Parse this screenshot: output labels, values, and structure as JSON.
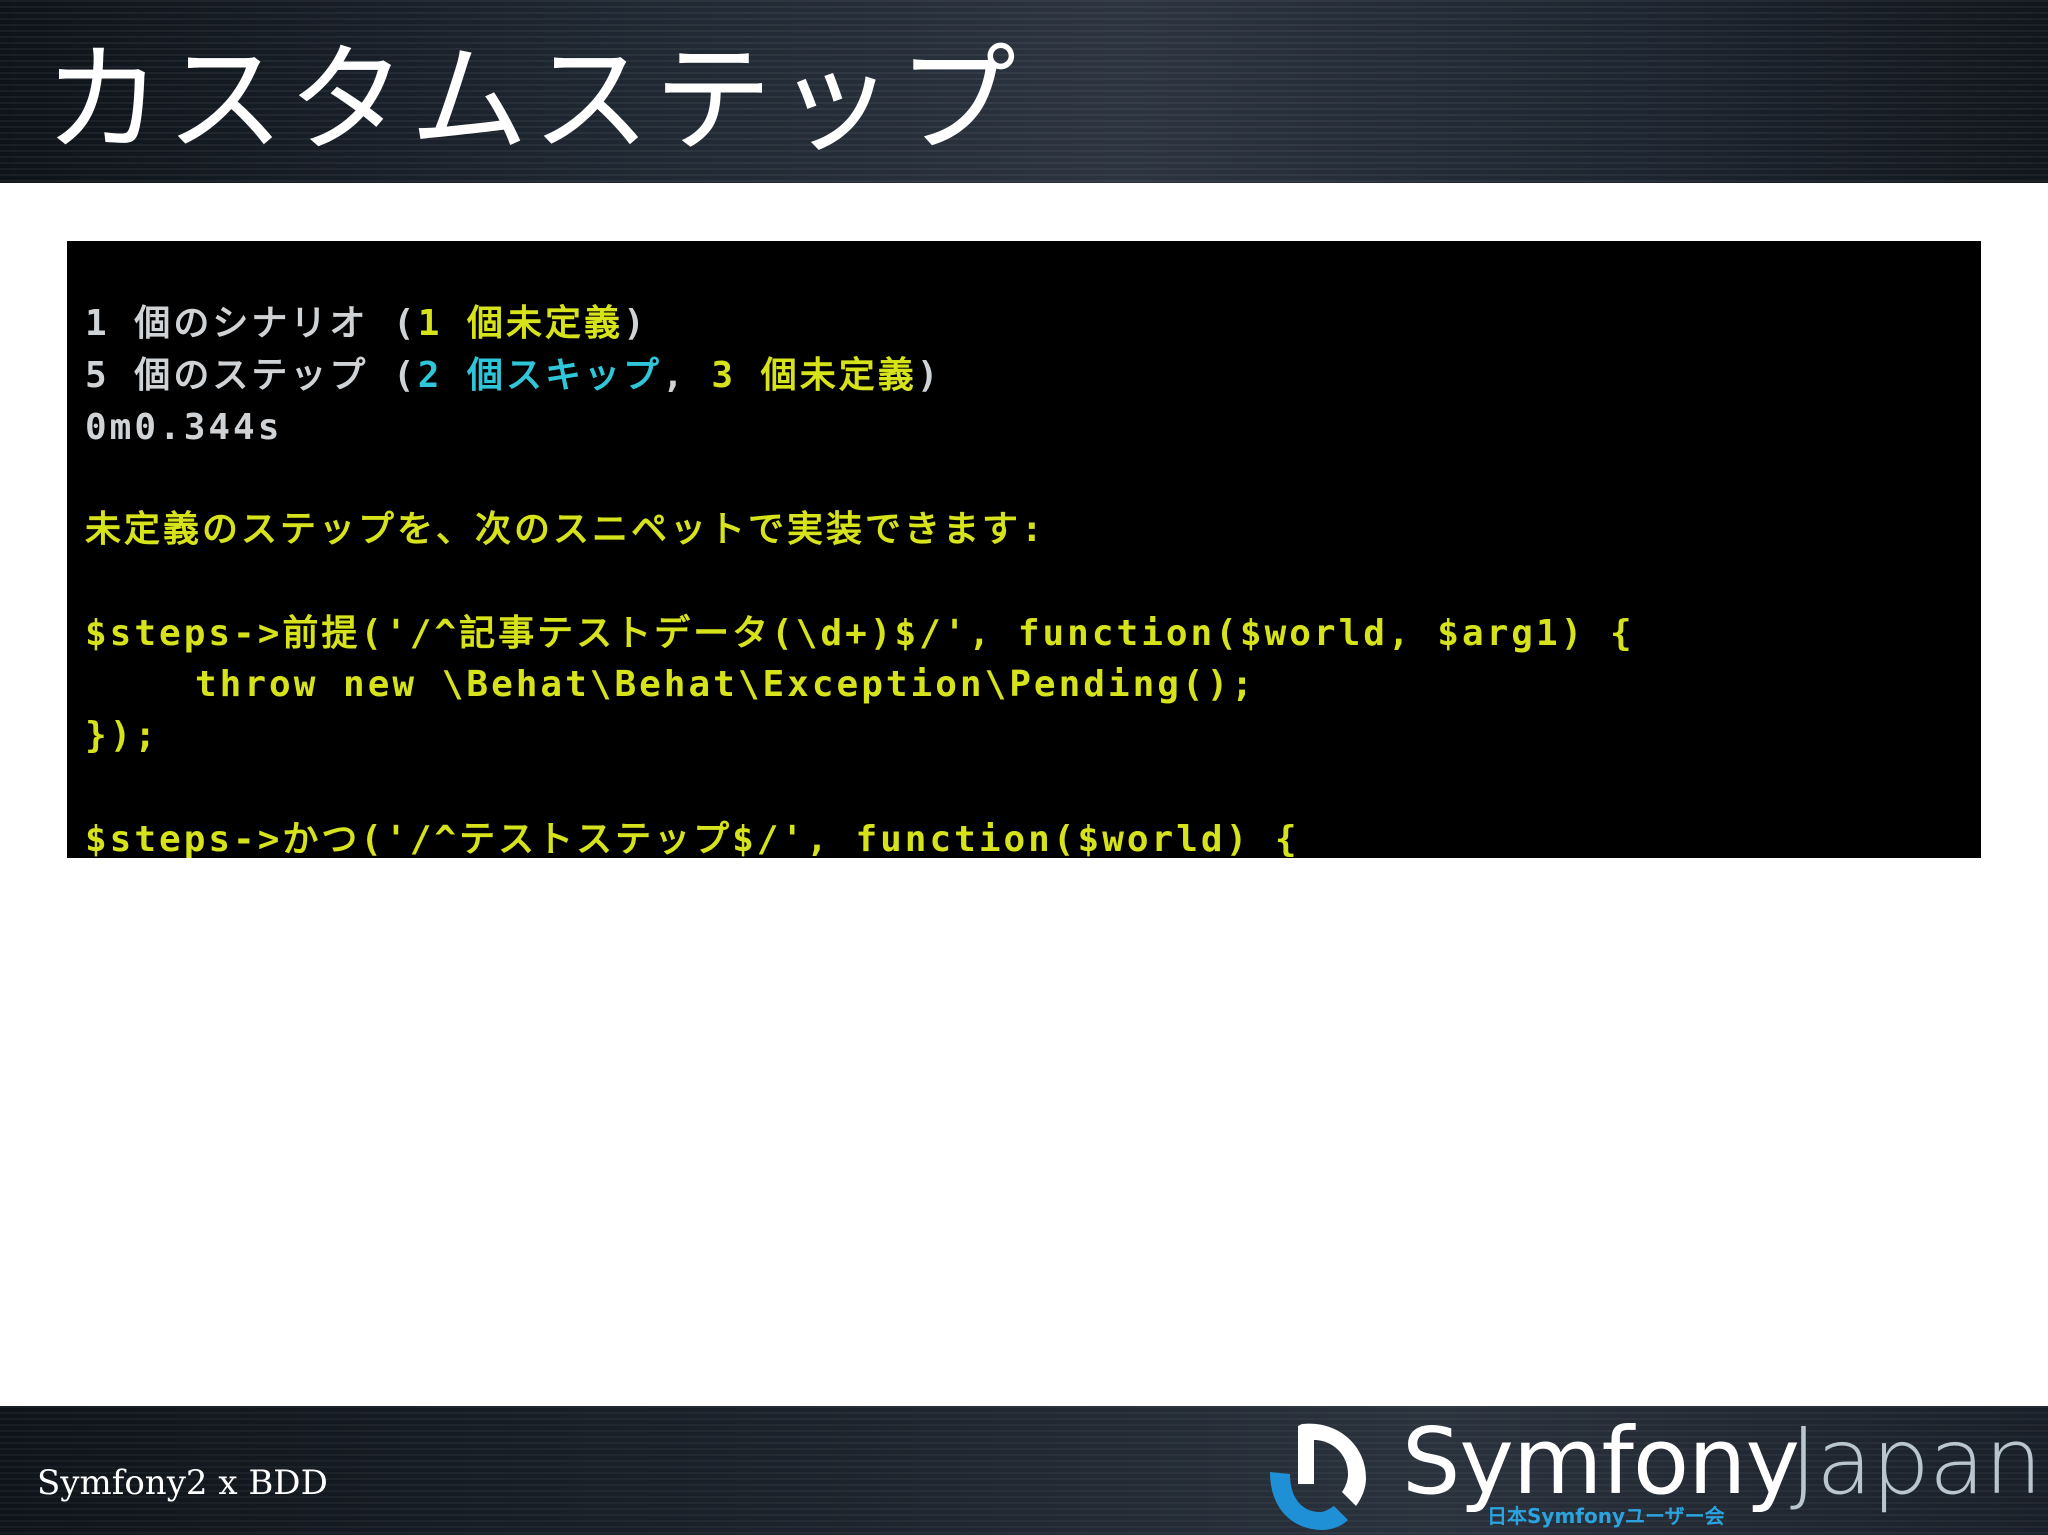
{
  "slide": {
    "title": "カスタムステップ",
    "footer": "Symfony2 x BDD"
  },
  "terminal": {
    "line1_white_a": "1 個のシナリオ (",
    "line1_yellow": "1 個未定義",
    "line1_white_b": ")",
    "line2_white_a": "5 個のステップ (",
    "line2_cyan": "2 個スキップ",
    "line2_white_b": ", ",
    "line2_yellow": "3 個未定義",
    "line2_white_c": ")",
    "line3": "0m0.344s",
    "line4": "未定義のステップを、次のスニペットで実装できます:",
    "line5": "$steps->前提('/^記事テストデータ(\\d+)$/', function($world, $arg1) {",
    "line6": "throw new \\Behat\\Behat\\Exception\\Pending();",
    "line7": "});",
    "line8": "$steps->かつ('/^テストステップ$/', function($world) {"
  },
  "logo": {
    "word1": "Symfony",
    "word2": "Japan",
    "subtitle": "日本Symfonyユーザー会"
  },
  "colors": {
    "terminal_yellow": "#d6e21a",
    "terminal_cyan": "#2ec6d8",
    "terminal_white": "#cfd3d6",
    "logo_blue": "#2aa3df"
  }
}
